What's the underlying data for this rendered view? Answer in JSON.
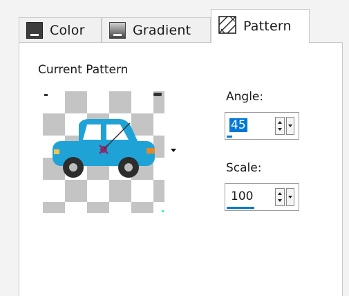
{
  "tabs": [
    {
      "label": "Color",
      "icon": "color-swatch-icon",
      "active": false
    },
    {
      "label": "Gradient",
      "icon": "gradient-swatch-icon",
      "active": false
    },
    {
      "label": "Pattern",
      "icon": "pattern-swatch-icon",
      "active": true
    }
  ],
  "pattern": {
    "heading": "Current Pattern",
    "preview_icon": "car-icon"
  },
  "angle": {
    "label": "Angle:",
    "value": "45",
    "selected": true
  },
  "scale": {
    "label": "Scale:",
    "value": "100"
  },
  "colors": {
    "accent": "#0078d7",
    "car_body": "#1fa3d6",
    "checker": "#c4c4c4"
  }
}
